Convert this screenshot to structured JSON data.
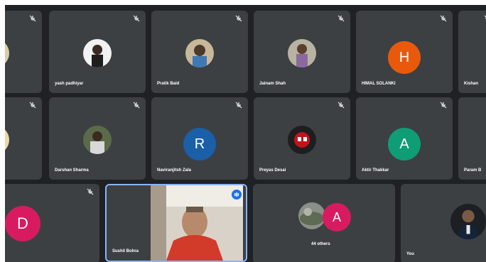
{
  "participants": [
    {
      "name": "yash padhiyar"
    },
    {
      "name": "Pratik Baid"
    },
    {
      "name": "Jainam Shah"
    },
    {
      "name": "HIMAL SOLANKI",
      "initial": "H",
      "color": "#e8590c"
    },
    {
      "name": "Kishan"
    },
    {
      "name": "Darshan Sharma"
    },
    {
      "name": "Naviranjitsh Zala",
      "initial": "R",
      "color": "#1a5fa8"
    },
    {
      "name": "Preyas Desai"
    },
    {
      "name": "Aktir Thakkar",
      "initial": "A",
      "color": "#0f9d75"
    },
    {
      "name": "Param B"
    }
  ],
  "bottom": {
    "left_initial": "D",
    "left_color": "#d81b60",
    "pinned_name": "Sushil Bohra",
    "others_initial": "A",
    "others_color": "#d81b60",
    "others_label": "44 others",
    "you_label": "You"
  },
  "icons": {
    "mute": "mic-off-icon",
    "speaking": "speaking-indicator-icon"
  }
}
